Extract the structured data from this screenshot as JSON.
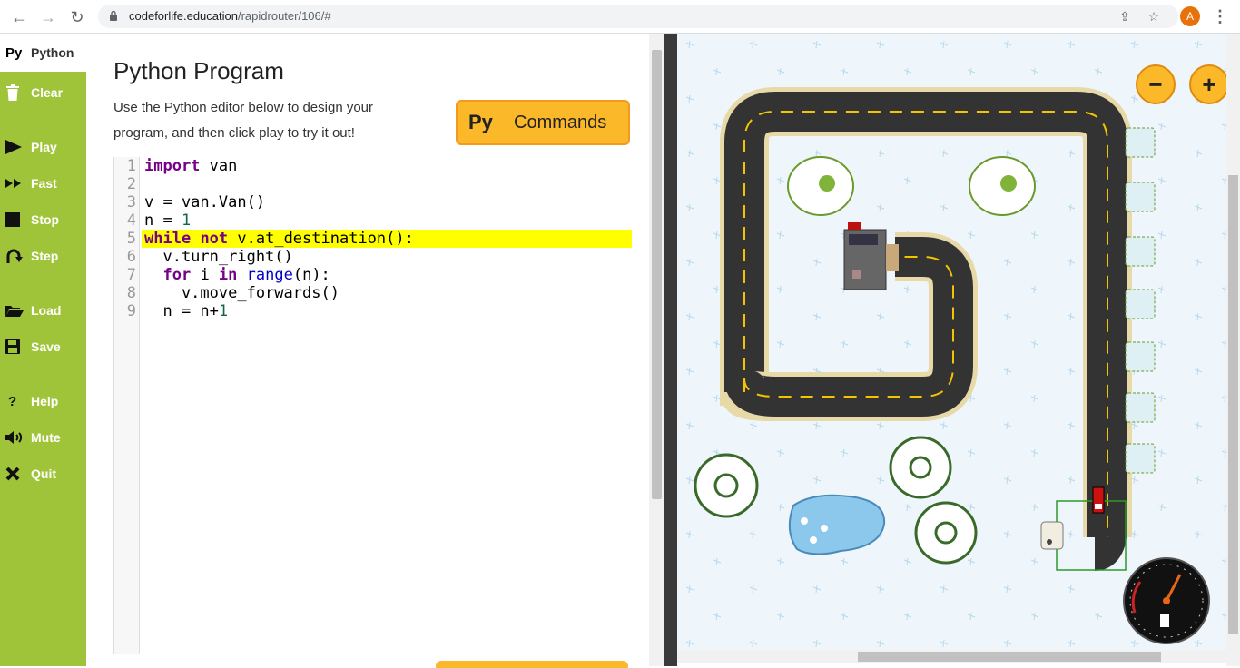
{
  "browser": {
    "url_host": "codeforlife.education",
    "url_path": "/rapidrouter/106/#",
    "avatar_initial": "A"
  },
  "sidebar": {
    "tab": {
      "icon": "Py",
      "label": "Python"
    },
    "items": [
      {
        "label": "Clear",
        "icon": "trash-icon"
      },
      {
        "label": "Play",
        "icon": "play-icon"
      },
      {
        "label": "Fast",
        "icon": "fast-forward-icon"
      },
      {
        "label": "Stop",
        "icon": "stop-icon"
      },
      {
        "label": "Step",
        "icon": "step-icon"
      },
      {
        "label": "Load",
        "icon": "folder-icon"
      },
      {
        "label": "Save",
        "icon": "floppy-icon"
      },
      {
        "label": "Help",
        "icon": "question-icon"
      },
      {
        "label": "Mute",
        "icon": "speaker-icon"
      },
      {
        "label": "Quit",
        "icon": "x-icon"
      }
    ]
  },
  "editor": {
    "title": "Python Program",
    "description": "Use the Python editor below to design your program, and then click play to try it out!",
    "commands_button": {
      "icon": "Py",
      "label": "Commands"
    },
    "highlighted_line": 5,
    "lines": [
      "import van",
      "",
      "v = van.Van()",
      "n = 1",
      "while not v.at_destination():",
      "  v.turn_right()",
      "  for i in range(n):",
      "    v.move_forwards()",
      "  n = n+1"
    ]
  },
  "game": {
    "zoom_out_label": "−",
    "zoom_in_label": "+",
    "colors": {
      "road": "#333333",
      "kerb": "#e8d9a8",
      "lane": "#f5c400",
      "snow": "#eef6fb",
      "van": "#cc1111"
    }
  }
}
